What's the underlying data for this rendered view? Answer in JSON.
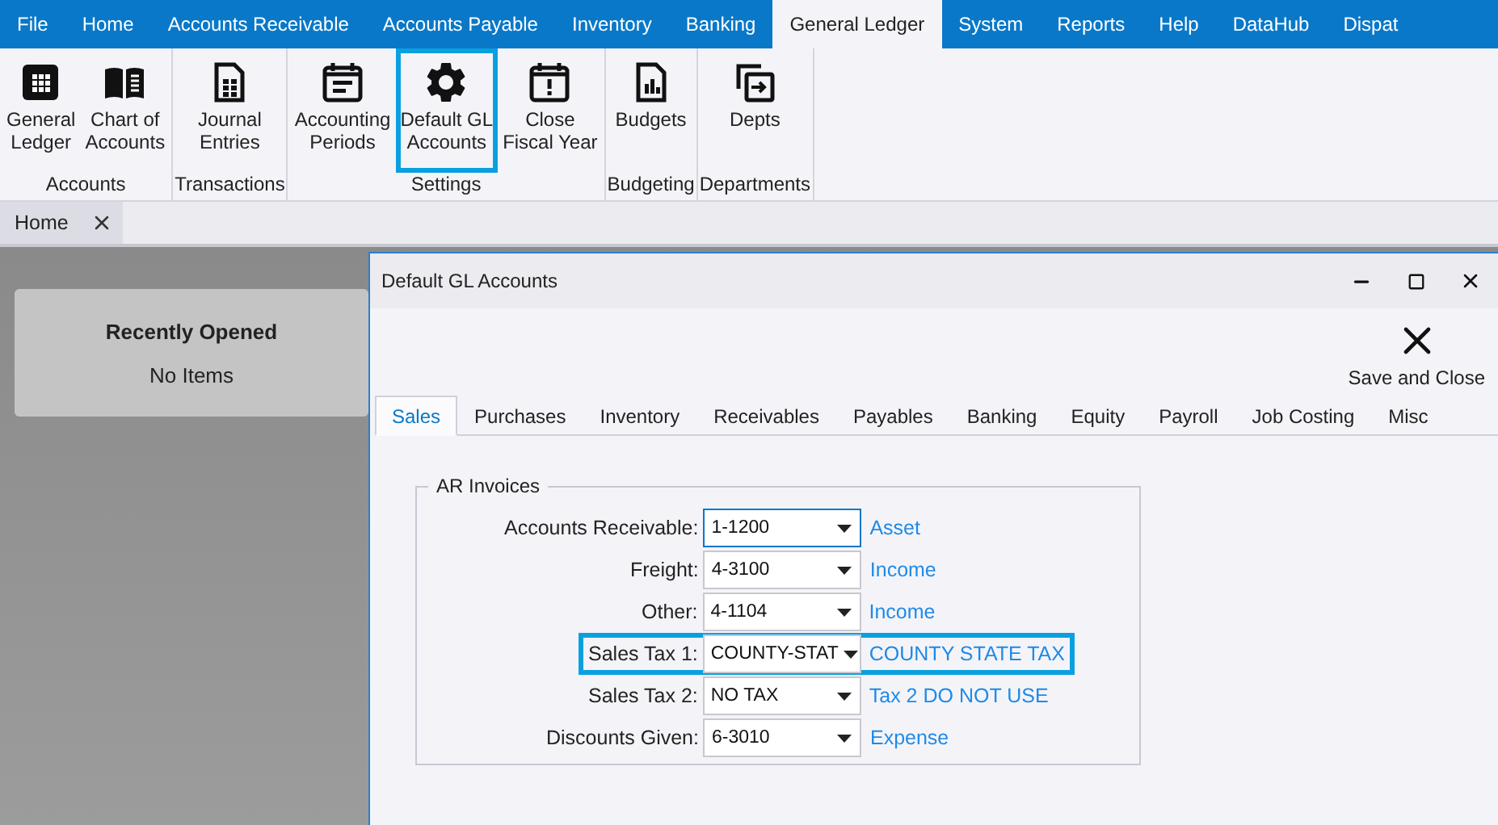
{
  "menu": [
    {
      "label": "File",
      "selected": false
    },
    {
      "label": "Home",
      "selected": false
    },
    {
      "label": "Accounts Receivable",
      "selected": false
    },
    {
      "label": "Accounts Payable",
      "selected": false
    },
    {
      "label": "Inventory",
      "selected": false
    },
    {
      "label": "Banking",
      "selected": false
    },
    {
      "label": "General Ledger",
      "selected": true
    },
    {
      "label": "System",
      "selected": false
    },
    {
      "label": "Reports",
      "selected": false
    },
    {
      "label": "Help",
      "selected": false
    },
    {
      "label": "DataHub",
      "selected": false
    },
    {
      "label": "Dispat",
      "selected": false
    }
  ],
  "ribbon": {
    "groups": [
      {
        "label": "Accounts",
        "buttons": [
          {
            "label": "General\nLedger",
            "highlighted": false
          },
          {
            "label": "Chart of\nAccounts",
            "highlighted": false
          }
        ]
      },
      {
        "label": "Transactions",
        "buttons": [
          {
            "label": "Journal\nEntries",
            "highlighted": false
          }
        ]
      },
      {
        "label": "Settings",
        "buttons": [
          {
            "label": "Accounting\nPeriods",
            "highlighted": false
          },
          {
            "label": "Default GL\nAccounts",
            "highlighted": true
          },
          {
            "label": "Close\nFiscal Year",
            "highlighted": false
          }
        ]
      },
      {
        "label": "Budgeting",
        "buttons": [
          {
            "label": "Budgets",
            "highlighted": false
          }
        ]
      },
      {
        "label": "Departments",
        "buttons": [
          {
            "label": "Depts",
            "highlighted": false
          }
        ]
      }
    ]
  },
  "doc_tabs": [
    {
      "label": "Home",
      "selected": true
    }
  ],
  "recent": {
    "title": "Recently Opened",
    "empty_text": "No Items"
  },
  "dialog": {
    "title": "Default GL Accounts",
    "save_close": "Save and Close",
    "tabs": [
      {
        "label": "Sales",
        "selected": true
      },
      {
        "label": "Purchases",
        "selected": false
      },
      {
        "label": "Inventory",
        "selected": false
      },
      {
        "label": "Receivables",
        "selected": false
      },
      {
        "label": "Payables",
        "selected": false
      },
      {
        "label": "Banking",
        "selected": false
      },
      {
        "label": "Equity",
        "selected": false
      },
      {
        "label": "Payroll",
        "selected": false
      },
      {
        "label": "Job Costing",
        "selected": false
      },
      {
        "label": "Misc",
        "selected": false
      }
    ],
    "group": {
      "title": "AR Invoices",
      "rows": [
        {
          "label": "Accounts Receivable:",
          "value": "1-1200",
          "link": "Asset",
          "focused": true,
          "highlighted": false
        },
        {
          "label": "Freight:",
          "value": "4-3100",
          "link": "Income",
          "focused": false,
          "highlighted": false
        },
        {
          "label": "Other:",
          "value": "4-1104",
          "link": "Income",
          "focused": false,
          "highlighted": false
        },
        {
          "label": "Sales Tax 1:",
          "value": "COUNTY-STAT",
          "link": "COUNTY STATE TAX",
          "focused": false,
          "highlighted": true
        },
        {
          "label": "Sales Tax 2:",
          "value": "NO TAX",
          "link": "Tax 2 DO NOT USE",
          "focused": false,
          "highlighted": false
        },
        {
          "label": "Discounts Given:",
          "value": "6-3010",
          "link": "Expense",
          "focused": false,
          "highlighted": false
        }
      ]
    }
  }
}
